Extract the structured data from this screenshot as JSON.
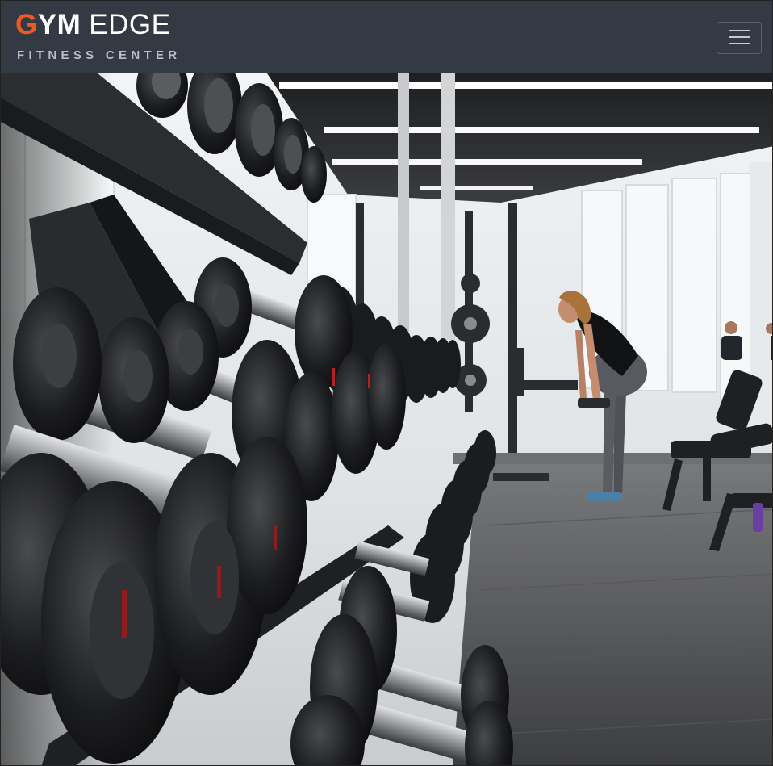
{
  "brand": {
    "g": "G",
    "ym": "YM",
    "edge": "EDGE",
    "subtitle": "FITNESS CENTER"
  },
  "navbar": {
    "menu_icon": "hamburger-icon",
    "background": "#343a44"
  },
  "hero": {
    "description_icon": "gym-dumbbell-rack-photo"
  },
  "colors": {
    "accent": "#ee5a24",
    "text": "#ffffff",
    "subtitle": "#b9bec6"
  }
}
